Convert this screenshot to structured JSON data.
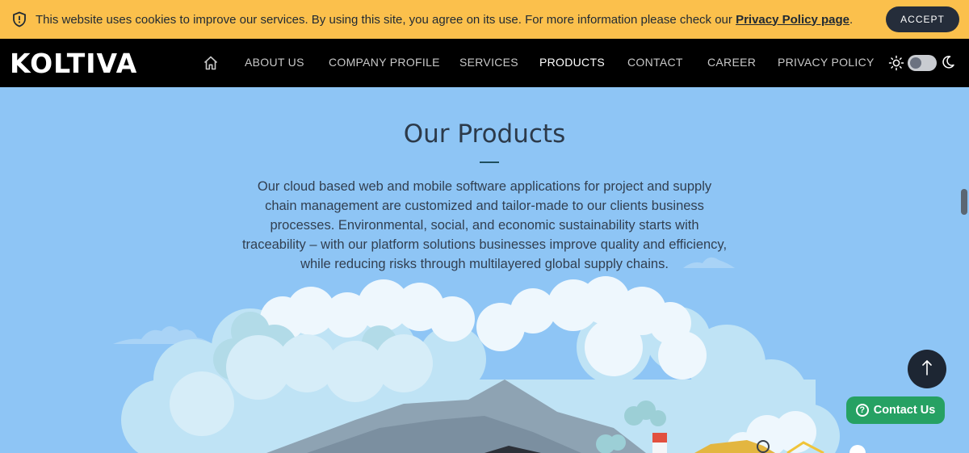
{
  "cookie": {
    "message": "This website uses cookies to improve our services. By using this site, you agree on its use. For more information please check our ",
    "link_label": "Privacy Policy page",
    "suffix": ".",
    "accept_label": "ACCEPT"
  },
  "brand": {
    "logo_text": "KOLTIVA"
  },
  "nav": {
    "items": [
      {
        "label": "ABOUT US"
      },
      {
        "label": "COMPANY PROFILE"
      },
      {
        "label": "SERVICES"
      },
      {
        "label": "PRODUCTS"
      },
      {
        "label": "CONTACT"
      },
      {
        "label": "CAREER"
      },
      {
        "label": "PRIVACY POLICY"
      }
    ],
    "active": "PRODUCTS"
  },
  "theme_toggle": {
    "mode": "light"
  },
  "main": {
    "title": "Our Products",
    "description": "Our cloud based web and mobile software applications for project and supply chain management are customized and tailor-made to our clients business processes. Environmental, social, and economic sustainability starts with traceability – with our platform solutions businesses improve quality and efficiency, while reducing risks through multilayered global supply chains."
  },
  "floating": {
    "contact_label": "Contact Us"
  },
  "colors": {
    "cookie_bg": "#fbc04c",
    "nav_bg": "#000000",
    "sky": "#8ec5f5",
    "contact_green": "#26a163",
    "scroll_button": "#1d2633"
  }
}
